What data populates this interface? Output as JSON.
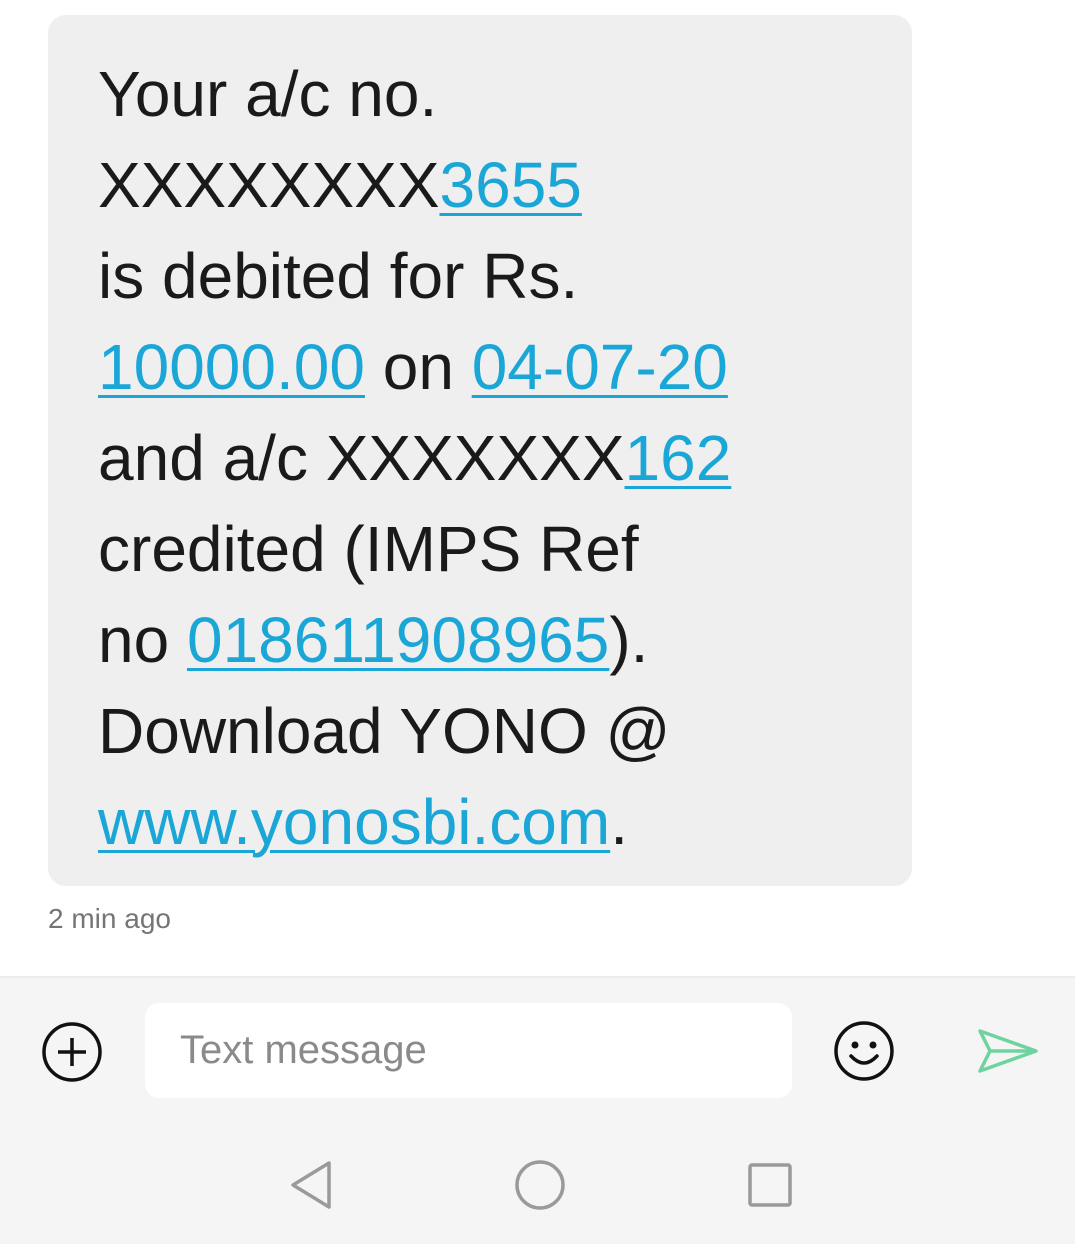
{
  "message": {
    "lines": [
      [
        {
          "text": "Your a/c no."
        }
      ],
      [
        {
          "text": "XXXXXXXX"
        },
        {
          "text": "3655",
          "link": true
        }
      ],
      [
        {
          "text": "is debited for Rs."
        }
      ],
      [
        {
          "text": "10000.00",
          "link": true
        },
        {
          "text": " on "
        },
        {
          "text": "04-07-20",
          "link": true
        }
      ],
      [
        {
          "text": "and a/c XXXXXXX"
        },
        {
          "text": "162",
          "link": true
        }
      ],
      [
        {
          "text": "credited (IMPS Ref"
        }
      ],
      [
        {
          "text": "no "
        },
        {
          "text": "018611908965",
          "link": true
        },
        {
          "text": ")."
        }
      ],
      [
        {
          "text": "Download YONO @"
        }
      ],
      [
        {
          "text": "www.yonosbi.com",
          "link": true
        },
        {
          "text": "."
        }
      ]
    ],
    "timestamp": "2 min ago"
  },
  "composer": {
    "placeholder": "Text message",
    "attach_icon": "add-circle-icon",
    "emoji_icon": "emoji-smile-icon",
    "send_icon": "send-icon",
    "send_color": "#6fd3a0"
  },
  "navbar": {
    "back_icon": "back-triangle-icon",
    "home_icon": "home-circle-icon",
    "recents_icon": "recents-square-icon"
  },
  "colors": {
    "link": "#1aa6d6",
    "bubble": "#efefef",
    "text": "#1a1a1a"
  }
}
